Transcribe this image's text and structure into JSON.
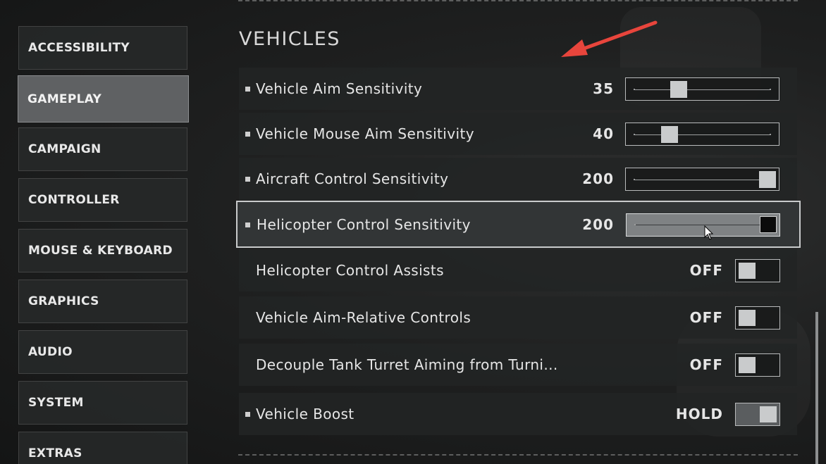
{
  "sidebar": {
    "items": [
      {
        "label": "ACCESSIBILITY"
      },
      {
        "label": "GAMEPLAY"
      },
      {
        "label": "CAMPAIGN"
      },
      {
        "label": "CONTROLLER"
      },
      {
        "label": "MOUSE & KEYBOARD"
      },
      {
        "label": "GRAPHICS"
      },
      {
        "label": "AUDIO"
      },
      {
        "label": "SYSTEM"
      },
      {
        "label": "EXTRAS"
      }
    ],
    "active": "GAMEPLAY"
  },
  "section": {
    "title": "VEHICLES"
  },
  "settings": {
    "rows": [
      {
        "label": "Vehicle Aim Sensitivity",
        "value": "35",
        "fraction": 0.32
      },
      {
        "label": "Vehicle Mouse Aim Sensitivity",
        "value": "40",
        "fraction": 0.25
      },
      {
        "label": "Aircraft Control Sensitivity",
        "value": "200",
        "fraction": 1.0
      },
      {
        "label": "Helicopter Control Sensitivity",
        "value": "200",
        "fraction": 1.0,
        "selected": true
      },
      {
        "label": "Helicopter Control Assists",
        "value": "OFF"
      },
      {
        "label": "Vehicle Aim-Relative Controls",
        "value": "OFF"
      },
      {
        "label": "Decouple Tank Turret Aiming from Turni...",
        "value": "OFF"
      },
      {
        "label": "Vehicle Boost",
        "value": "HOLD"
      }
    ]
  },
  "colors": {
    "annotation_arrow": "#e8453c",
    "active_tab": "#5f6163",
    "selected_border": "#c9cbcc"
  },
  "icons": {
    "annotation": "red-arrow-icon",
    "cursor": "mouse-cursor-icon"
  }
}
